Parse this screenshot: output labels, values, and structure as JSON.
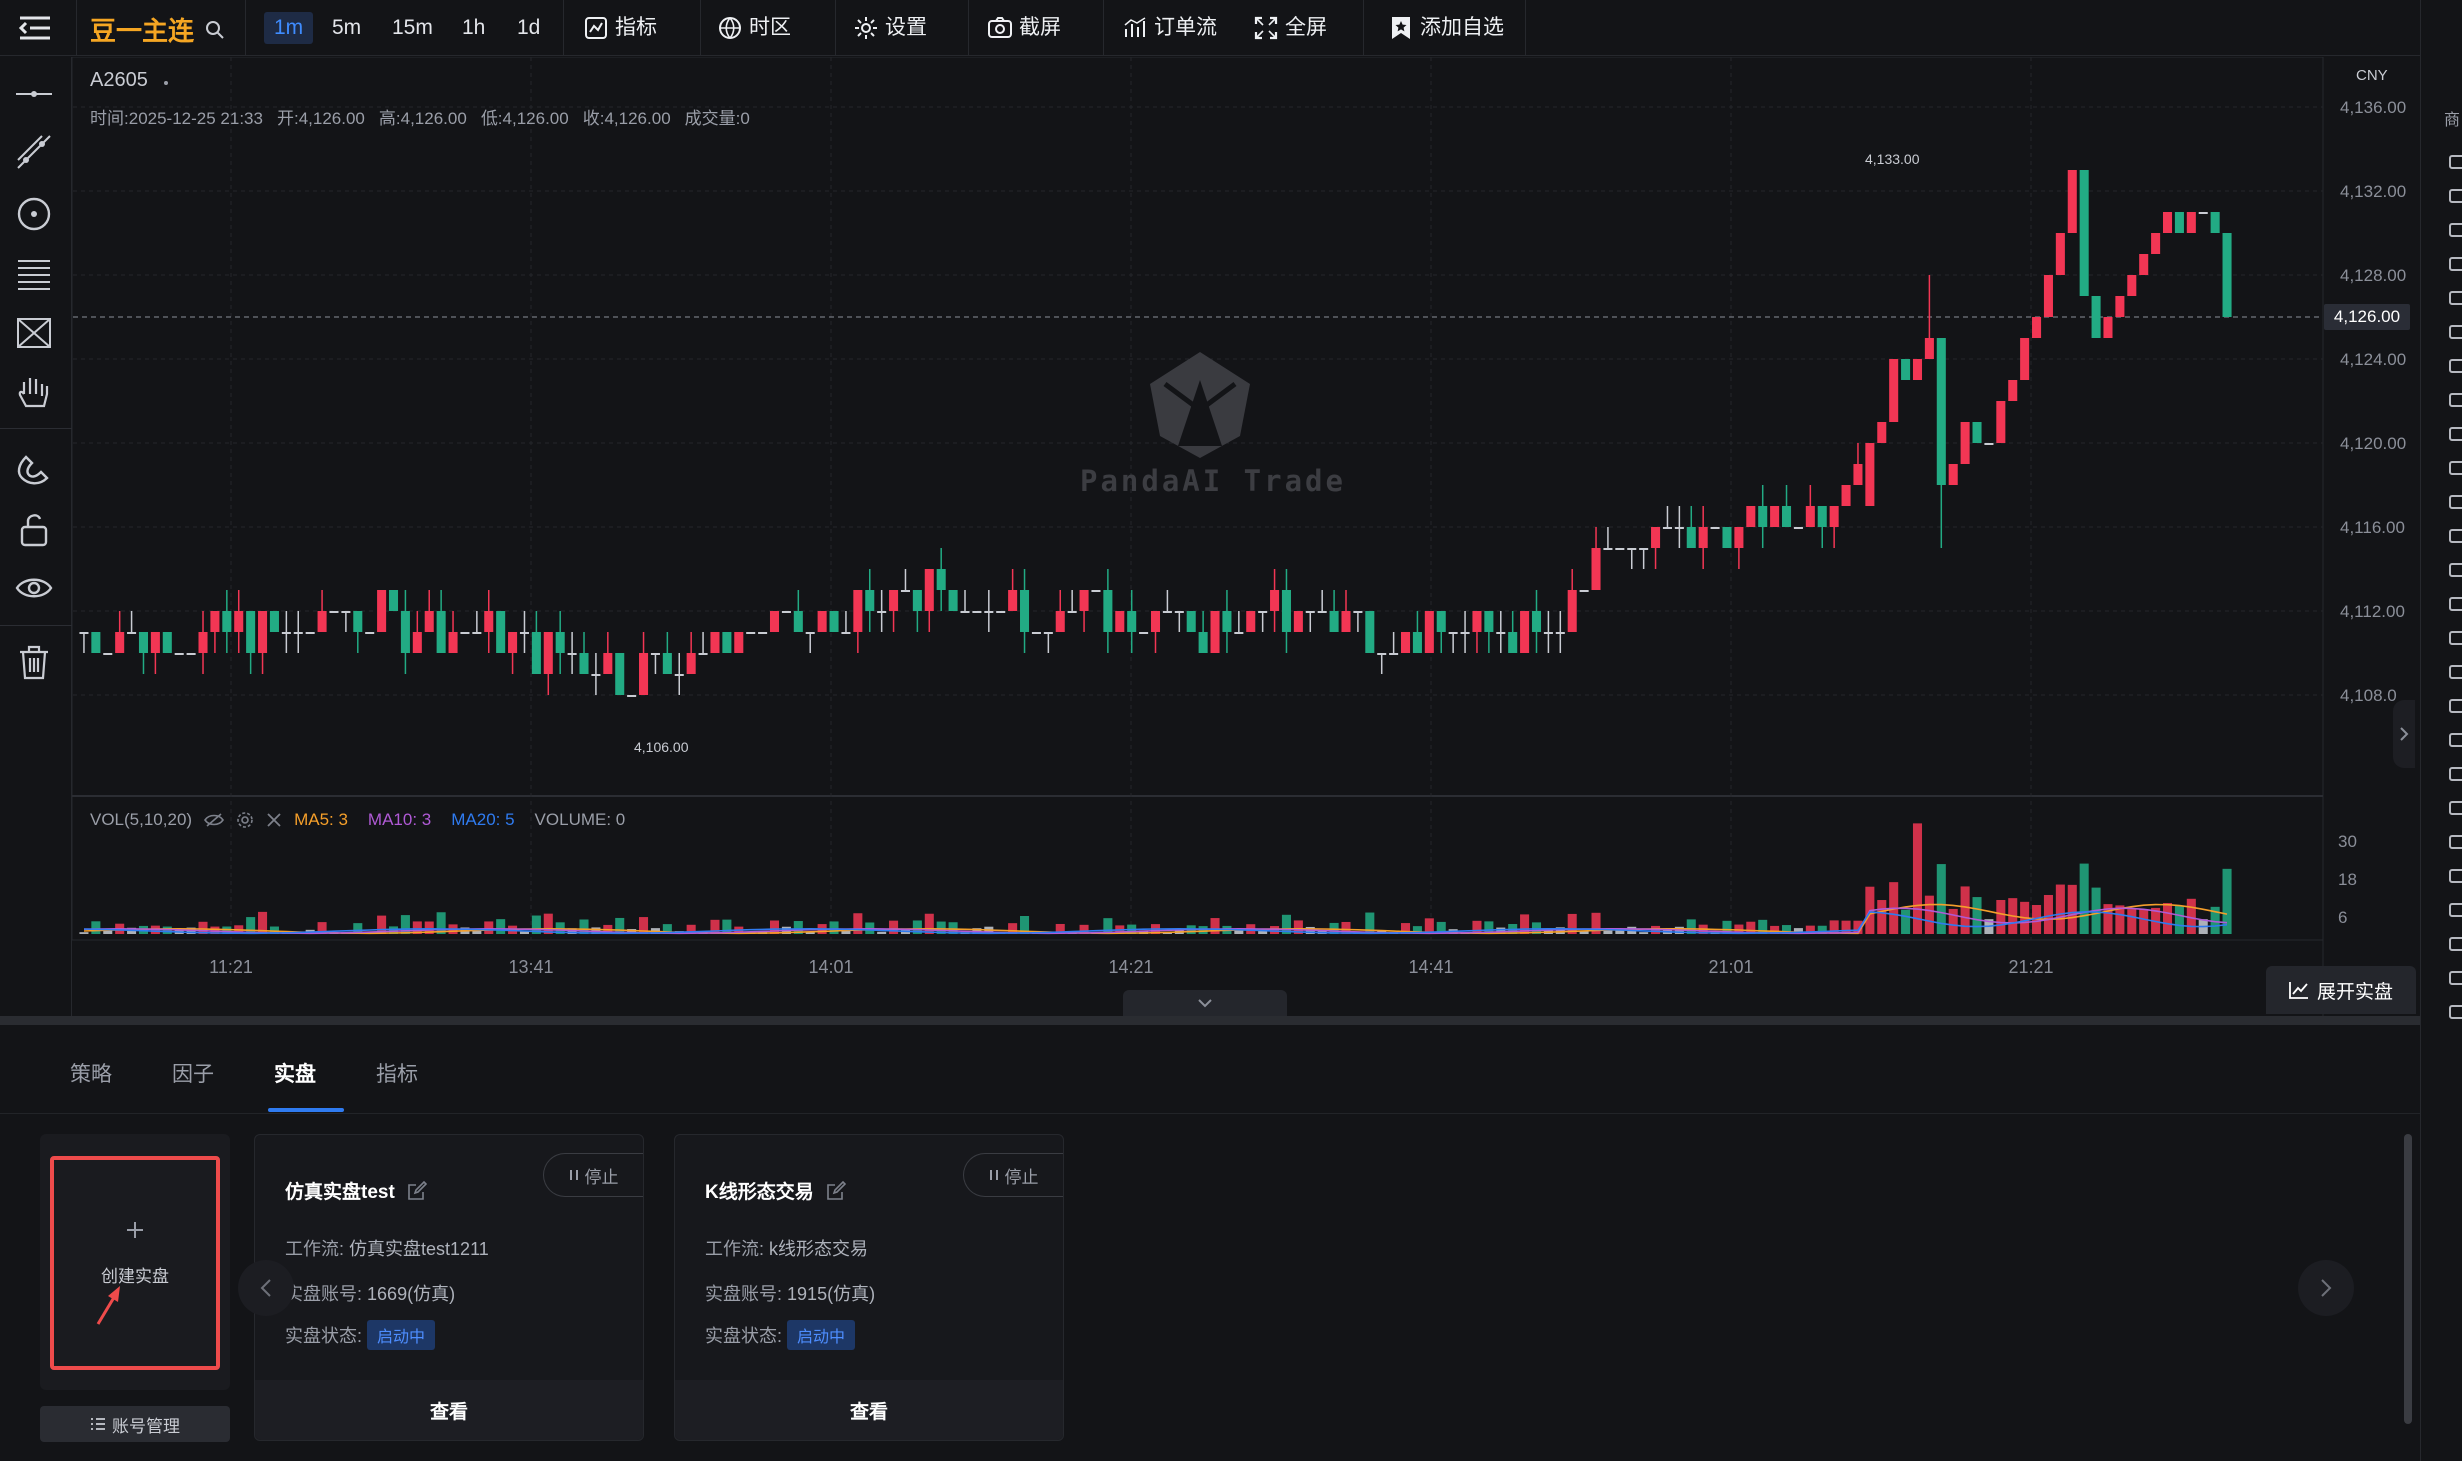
{
  "header": {
    "symbol_title": "豆一主连",
    "timeframes": [
      "1m",
      "5m",
      "15m",
      "1h",
      "1d"
    ],
    "active_timeframe": "1m",
    "buttons": {
      "indicators": "指标",
      "timezone": "时区",
      "settings": "设置",
      "screenshot": "截屏",
      "orderflow": "订单流",
      "fullscreen": "全屏",
      "add_watchlist": "添加自选"
    }
  },
  "chart": {
    "symbol": "A2605",
    "ohlc": {
      "time_label": "时间:",
      "time": "2025-12-25 21:33",
      "open_label": "开:",
      "open": "4,126.00",
      "high_label": "高:",
      "high": "4,126.00",
      "low_label": "低:",
      "low": "4,126.00",
      "close_label": "收:",
      "close": "4,126.00",
      "volume_label": "成交量:",
      "volume": "0"
    },
    "currency": "CNY",
    "current_price": "4,126.00",
    "y_ticks": [
      "4,136.00",
      "4,132.00",
      "4,128.00",
      "4,124.00",
      "4,120.00",
      "4,116.00",
      "4,112.00",
      "4,108.0"
    ],
    "high_marker": "4,133.00",
    "low_marker": "4,106.00",
    "watermark": "PandaAI Trade",
    "volume_panel": {
      "label": "VOL(5,10,20)",
      "ma5": "MA5: 3",
      "ma10": "MA10: 3",
      "ma20": "MA20: 5",
      "volume": "VOLUME: 0",
      "y_ticks": [
        "30",
        "18",
        "6"
      ]
    },
    "time_ticks": [
      "11:21",
      "13:41",
      "14:01",
      "14:21",
      "14:41",
      "21:01",
      "21:21"
    ],
    "expand_live": "展开实盘",
    "colors": {
      "up": "#f23654",
      "down": "#22ab84",
      "ma5": "#f59f2a",
      "ma10": "#b05ad6",
      "ma20": "#2f7bf0"
    }
  },
  "bottom": {
    "tabs": [
      "策略",
      "因子",
      "实盘",
      "指标"
    ],
    "active_tab": "实盘",
    "create_label": "创建实盘",
    "account_mgmt": "账号管理",
    "cards": [
      {
        "title": "仿真实盘test",
        "stop": "停止",
        "workflow_label": "工作流:",
        "workflow": "仿真实盘test1211",
        "account_label": "实盘账号:",
        "account": "1669(仿真)",
        "status_label": "实盘状态:",
        "status": "启动中",
        "view": "查看"
      },
      {
        "title": "K线形态交易",
        "stop": "停止",
        "workflow_label": "工作流:",
        "workflow": "k线形态交易",
        "account_label": "实盘账号:",
        "account": "1915(仿真)",
        "status_label": "实盘状态:",
        "status": "启动中",
        "view": "查看"
      }
    ]
  },
  "right_strip": {
    "label": "商"
  }
}
